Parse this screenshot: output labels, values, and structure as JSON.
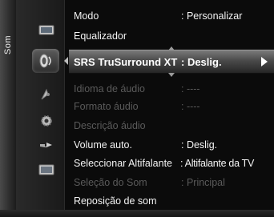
{
  "panel": {
    "side_tab_label": "Som"
  },
  "menu": {
    "rows": [
      {
        "label": "Modo",
        "value": ": Personalizar",
        "state": "on"
      },
      {
        "label": "Equalizador",
        "value": "",
        "state": "on"
      },
      {
        "label": "SRS TruSurround XT",
        "value": ": Deslig.",
        "state": "selected"
      },
      {
        "label": "Idioma de áudio",
        "value": ": ----",
        "state": "off"
      },
      {
        "label": "Formato áudio",
        "value": ": ----",
        "state": "off"
      },
      {
        "label": "Descrição áudio",
        "value": "",
        "state": "off"
      },
      {
        "label": "Volume auto.",
        "value": ": Deslig.",
        "state": "on"
      },
      {
        "label": "Seleccionar Altifalante",
        "value": ": Altifalante da TV",
        "state": "on"
      },
      {
        "label": "Seleção do Som",
        "value": ": Principal",
        "state": "off"
      },
      {
        "label": "Reposição de som",
        "value": "",
        "state": "on"
      }
    ]
  },
  "icons": [
    {
      "name": "picture-icon"
    },
    {
      "name": "sound-icon"
    },
    {
      "name": "channel-icon"
    },
    {
      "name": "setup-icon"
    },
    {
      "name": "input-icon"
    },
    {
      "name": "application-icon"
    }
  ],
  "colors": {
    "text_enabled": "#f4f4f4",
    "text_disabled": "#5a5a5a",
    "highlight": "#5a5a5a"
  }
}
